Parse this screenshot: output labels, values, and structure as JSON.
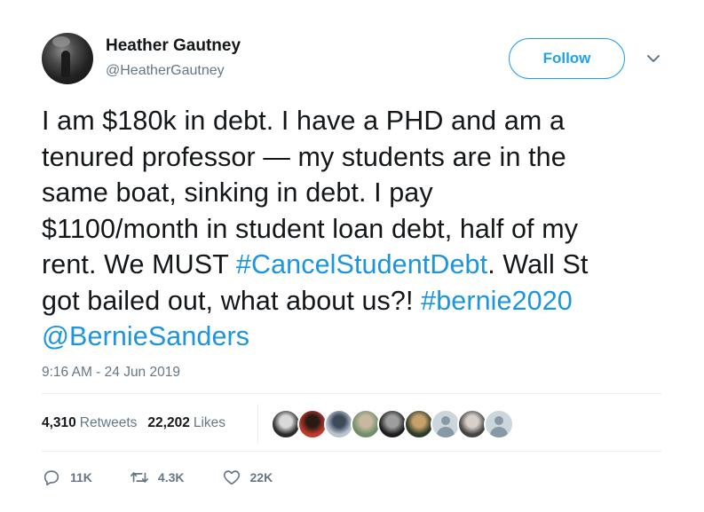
{
  "author": {
    "name": "Heather Gautney",
    "handle": "@HeatherGautney"
  },
  "follow_label": "Follow",
  "tweet": {
    "lines": [
      [
        {
          "t": "I am $180k in debt. I have a PHD and am a",
          "link": false
        }
      ],
      [
        {
          "t": "tenured professor — my students are in the",
          "link": false
        }
      ],
      [
        {
          "t": "same boat, sinking in debt. I pay",
          "link": false
        }
      ],
      [
        {
          "t": "$1100/month in student loan debt, half of my",
          "link": false
        }
      ],
      [
        {
          "t": "rent. We MUST ",
          "link": false
        },
        {
          "t": "#CancelStudentDebt",
          "link": true
        },
        {
          "t": ". Wall St",
          "link": false
        }
      ],
      [
        {
          "t": "got bailed out, what about us?! ",
          "link": false
        },
        {
          "t": "#bernie2020",
          "link": true
        }
      ],
      [
        {
          "t": "@BernieSanders",
          "link": true
        }
      ]
    ]
  },
  "timestamp": "9:16 AM - 24 Jun 2019",
  "stats": {
    "retweets_count": "4,310",
    "retweets_label": "Retweets",
    "likes_count": "22,202",
    "likes_label": "Likes"
  },
  "likers": [
    {
      "icon": "liker-avatar",
      "colors": [
        "#2b2b2b",
        "#d9d9d9"
      ]
    },
    {
      "icon": "liker-avatar",
      "colors": [
        "#c0392b",
        "#2a1a14"
      ]
    },
    {
      "icon": "liker-avatar",
      "colors": [
        "#b9c4cf",
        "#3d4a5a"
      ]
    },
    {
      "icon": "liker-avatar",
      "colors": [
        "#6f8f6a",
        "#c8b8a0"
      ]
    },
    {
      "icon": "liker-avatar",
      "colors": [
        "#1e1e1e",
        "#9e9e9e"
      ]
    },
    {
      "icon": "liker-avatar",
      "colors": [
        "#2c3b2a",
        "#c7a16a"
      ]
    },
    {
      "icon": "default-avatar",
      "colors": []
    },
    {
      "icon": "liker-avatar",
      "colors": [
        "#444",
        "#d8d0c8"
      ]
    },
    {
      "icon": "default-avatar",
      "colors": []
    }
  ],
  "actions": {
    "replies": "11K",
    "retweets": "4.3K",
    "likes": "22K"
  },
  "colors": {
    "accent": "#1da1f2",
    "link": "#1b95e0",
    "muted": "#657786",
    "text": "#14171a"
  }
}
